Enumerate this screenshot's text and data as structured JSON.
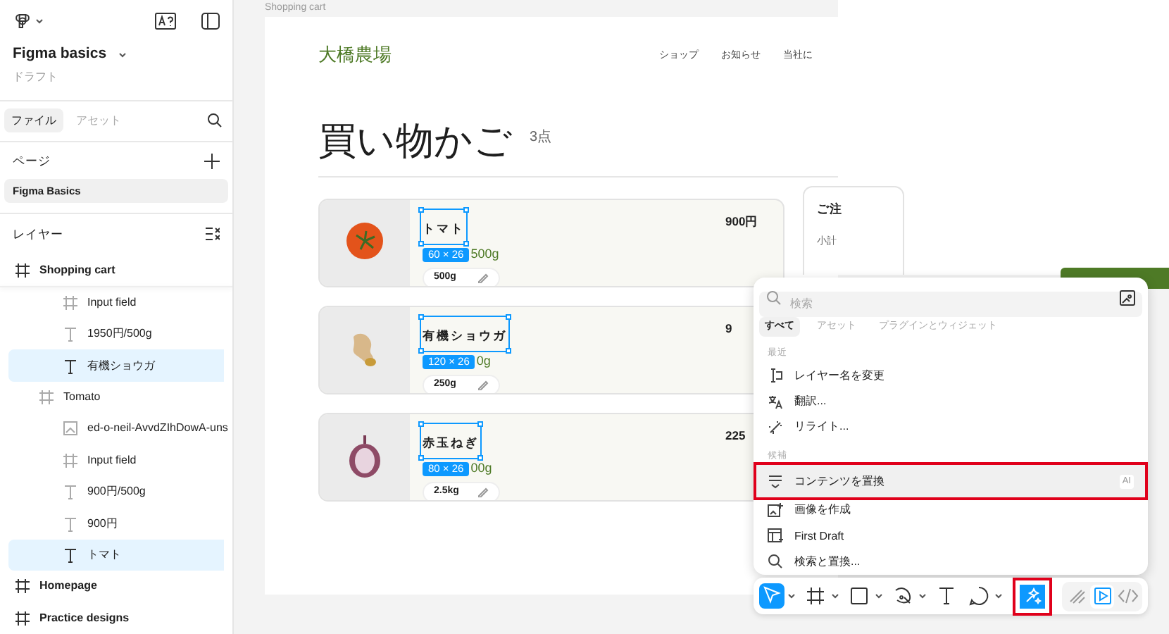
{
  "sidebar": {
    "file_name": "Figma basics",
    "subtitle": "ドラフト",
    "tabs": [
      {
        "label": "ファイル",
        "selected": true
      },
      {
        "label": "アセット",
        "selected": false
      }
    ],
    "pages_title": "ページ",
    "pages": [
      {
        "label": "Figma Basics",
        "selected": true
      }
    ],
    "layers_title": "レイヤー",
    "layers": [
      {
        "name": "Shopping cart",
        "kind": "frame",
        "selected": false,
        "children": [
          {
            "children": [
              {
                "name": "Input field",
                "kind": "frame",
                "selected": false
              },
              {
                "name": "1950円/500g",
                "kind": "text",
                "selected": false
              },
              {
                "name": "有機ショウガ",
                "kind": "text",
                "selected": true
              }
            ]
          },
          {
            "name": "Tomato",
            "kind": "frame",
            "selected": false,
            "children": [
              {
                "name": "ed-o-neil-AvvdZIhDowA-uns",
                "kind": "image",
                "selected": false
              },
              {
                "name": "Input field",
                "kind": "frame",
                "selected": false
              },
              {
                "name": "900円/500g",
                "kind": "text",
                "selected": false
              },
              {
                "name": "900円",
                "kind": "text",
                "selected": false
              },
              {
                "name": "トマト",
                "kind": "text",
                "selected": true
              }
            ]
          }
        ]
      },
      {
        "name": "Homepage",
        "kind": "frame",
        "selected": false
      },
      {
        "name": "Practice designs",
        "kind": "frame",
        "selected": false
      }
    ]
  },
  "canvas": {
    "frame_label": "Shopping cart",
    "logo": "大橋農場",
    "nav": [
      "ショップ",
      "お知らせ",
      "当社に"
    ],
    "heading": "買い物かご",
    "count": "3点",
    "items": [
      {
        "name": "トマト",
        "size": "60 × 26",
        "unit_price": "500g",
        "quantity": "500g",
        "price": "900円",
        "kind": "tomato"
      },
      {
        "name": "有機ショウガ",
        "size": "120 × 26",
        "unit_price": "0g",
        "quantity": "250g",
        "price": "9",
        "kind": "ginger"
      },
      {
        "name": "赤玉ねぎ",
        "size": "80 × 26",
        "unit_price": "00g",
        "quantity": "2.5kg",
        "price": "225",
        "kind": "onion"
      }
    ],
    "summary": {
      "title": "ご注",
      "row_label": "小計"
    }
  },
  "actions_menu": {
    "search_placeholder": "検索",
    "tabs": [
      {
        "label": "すべて",
        "selected": true
      },
      {
        "label": "アセット",
        "selected": false
      },
      {
        "label": "プラグインとウィジェット",
        "selected": false
      }
    ],
    "sections": [
      {
        "title": "最近",
        "items": [
          {
            "label": "レイヤー名を変更",
            "kind": "rename",
            "highlighted": false
          },
          {
            "label": "翻訳...",
            "kind": "translate",
            "highlighted": false
          },
          {
            "label": "リライト...",
            "kind": "rewrite",
            "highlighted": false
          }
        ]
      },
      {
        "title": "候補",
        "items": [
          {
            "label": "コンテンツを置換",
            "kind": "replace",
            "highlighted": true,
            "badge": "AI"
          },
          {
            "label": "画像を作成",
            "kind": "image",
            "highlighted": false
          },
          {
            "label": "First Draft",
            "kind": "draft",
            "highlighted": false
          },
          {
            "label": "検索と置換...",
            "kind": "search",
            "highlighted": false
          }
        ]
      }
    ]
  },
  "toolbar": {
    "tools": [
      {
        "kind": "move",
        "selected": true,
        "dropdown": true,
        "highlighted": false
      },
      {
        "kind": "frame",
        "selected": false,
        "dropdown": true,
        "highlighted": false
      },
      {
        "kind": "rectangle",
        "selected": false,
        "dropdown": true,
        "highlighted": false
      },
      {
        "kind": "pen",
        "selected": false,
        "dropdown": true,
        "highlighted": false
      },
      {
        "kind": "text",
        "selected": false,
        "dropdown": false,
        "highlighted": false
      },
      {
        "kind": "comment",
        "selected": false,
        "dropdown": true,
        "highlighted": false
      },
      {
        "kind": "actions",
        "selected": true,
        "dropdown": false,
        "highlighted": true
      }
    ],
    "modes": [
      {
        "kind": "draw",
        "selected": false
      },
      {
        "kind": "design",
        "selected": true
      },
      {
        "kind": "dev",
        "selected": false
      }
    ]
  }
}
